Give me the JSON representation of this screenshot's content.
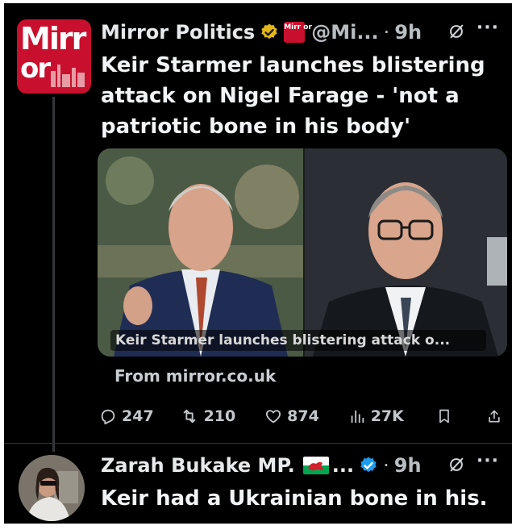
{
  "tweet1": {
    "author": {
      "name": "Mirror Politics",
      "handle": "@Mi...",
      "time": "9h",
      "avatar_text_line1": "Mirr",
      "avatar_text_line2": "or",
      "mini_logo_text": "Mirr or",
      "badge": "gold-verified-icon"
    },
    "text": "Keir Starmer launches blistering attack on Nigel Farage - 'not a patriotic bone in his body'",
    "card": {
      "caption": "Keir Starmer launches blistering attack o...",
      "source": "From mirror.co.uk"
    },
    "stats": {
      "replies": "247",
      "reposts": "210",
      "likes": "874",
      "views": "27K"
    },
    "more_label": "···"
  },
  "tweet2": {
    "author": {
      "name": "Zarah Bukake MP.",
      "ellipsis": "...",
      "time": "9h",
      "flag": "wales-flag-icon",
      "badge": "blue-verified-icon"
    },
    "text": "Keir had a Ukrainian bone in his.",
    "more_label": "···"
  },
  "colors": {
    "background": "#000000",
    "text": "#e7e9ea",
    "mirror_red": "#c8102e",
    "verified_blue": "#1d9bf0",
    "verified_gold": "#e2b719"
  }
}
